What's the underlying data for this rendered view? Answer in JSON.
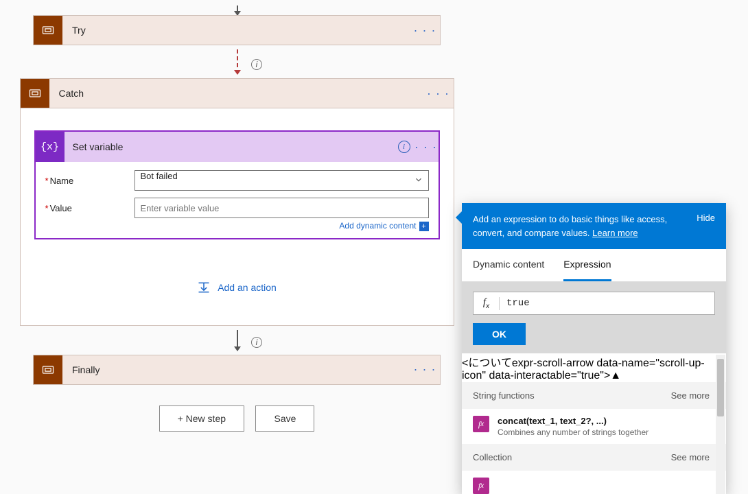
{
  "blocks": {
    "try": {
      "label": "Try"
    },
    "catch": {
      "label": "Catch"
    },
    "finally": {
      "label": "Finally"
    }
  },
  "action": {
    "title": "Set variable",
    "name_label": "Name",
    "name_value": "Bot failed",
    "value_label": "Value",
    "value_placeholder": "Enter variable value",
    "dynamic_link": "Add dynamic content"
  },
  "add_action": "Add an action",
  "buttons": {
    "new_step": "+ New step",
    "save": "Save"
  },
  "expr": {
    "banner": "Add an expression to do basic things like access, convert, and compare values.",
    "learn_more": "Learn more",
    "hide": "Hide",
    "tabs": {
      "dynamic": "Dynamic content",
      "expression": "Expression"
    },
    "input_value": "true",
    "ok": "OK",
    "sections": [
      {
        "title": "String functions",
        "see_more": "See more",
        "items": [
          {
            "sig": "concat(text_1, text_2?, ...)",
            "desc": "Combines any number of strings together"
          }
        ]
      },
      {
        "title": "Collection",
        "see_more": "See more",
        "items": []
      }
    ]
  }
}
